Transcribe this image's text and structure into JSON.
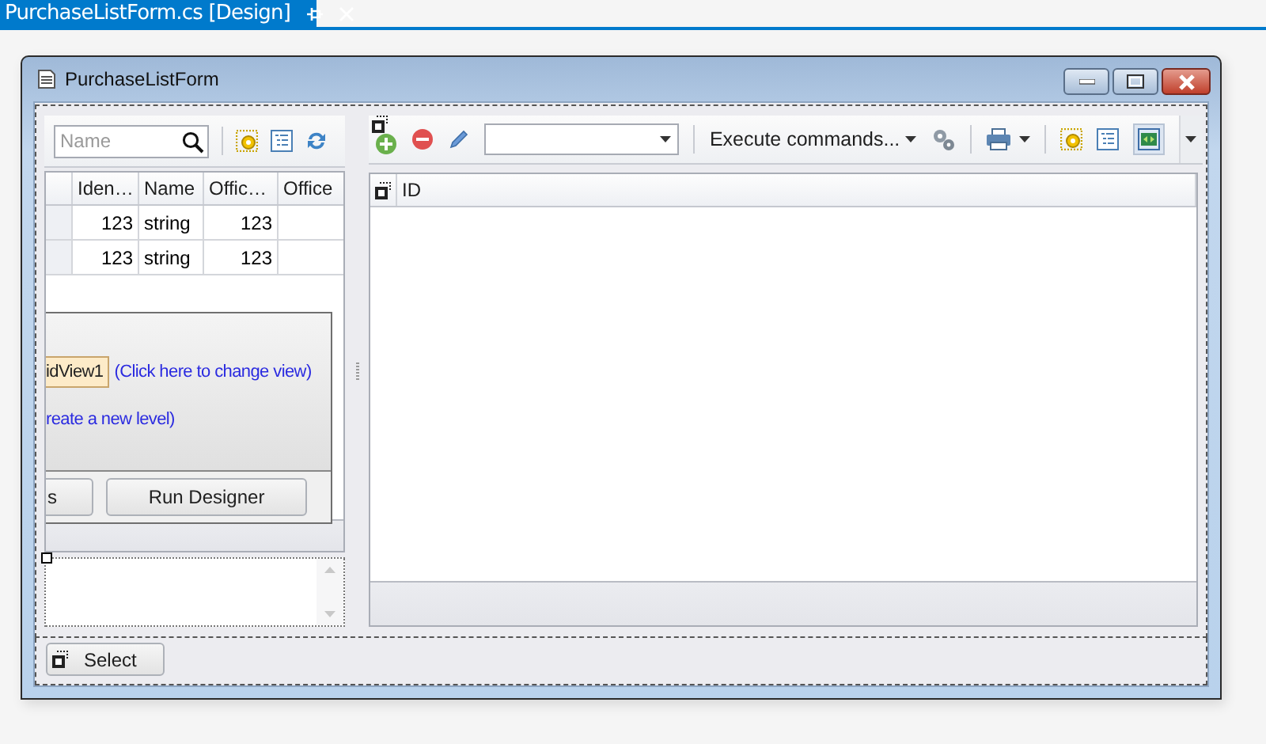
{
  "document_tab": {
    "title": "PurchaseListForm.cs [Design]"
  },
  "window": {
    "title": "PurchaseListForm"
  },
  "left_panel": {
    "search": {
      "placeholder": "Name"
    },
    "grid": {
      "columns": [
        "Iden…",
        "Name",
        "Offic…",
        "Office"
      ],
      "rows": [
        [
          "123",
          "string",
          "123",
          ""
        ],
        [
          "123",
          "string",
          "123",
          ""
        ]
      ]
    },
    "designer": {
      "view_button": "idView1",
      "change_view_link": "(Click here to change view)",
      "new_level_link": "reate a new level)",
      "buttons": [
        "s",
        "Run Designer"
      ]
    }
  },
  "right_panel": {
    "toolbar": {
      "execute_commands": "Execute commands..."
    },
    "grid": {
      "columns": [
        "ID"
      ]
    }
  },
  "bottom_bar": {
    "button": "Select"
  }
}
